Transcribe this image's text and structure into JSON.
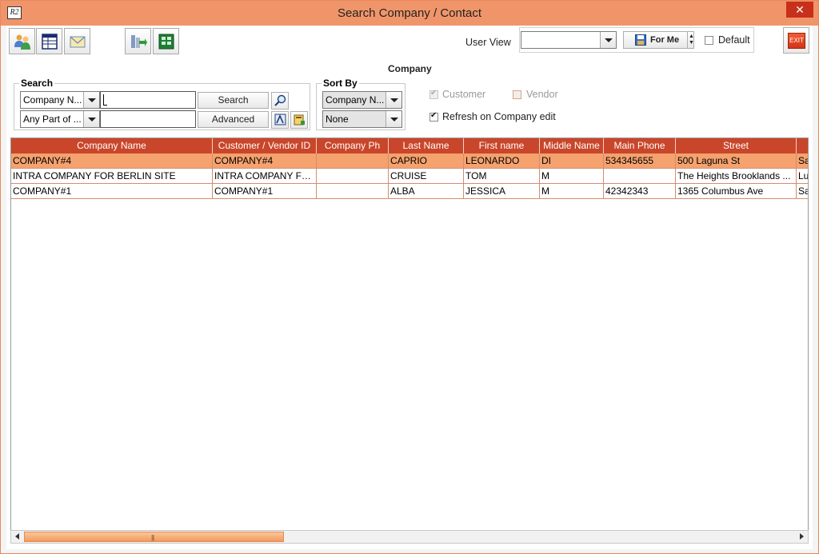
{
  "window": {
    "title": "Search Company / Contact",
    "app_icon_text": "R2",
    "close_symbol": "✕"
  },
  "toolbar": {
    "buttons": [
      {
        "icon": "contacts-icon"
      },
      {
        "icon": "table-window-icon"
      },
      {
        "icon": "envelope-icon"
      },
      {
        "icon": "export-icon"
      },
      {
        "icon": "spreadsheet-icon"
      }
    ],
    "user_view_label": "User View",
    "user_view_value": "",
    "for_me_label": "For Me",
    "default_label": "Default",
    "default_checked": false,
    "exit_label": "EXIT"
  },
  "section_title": "Company",
  "search": {
    "legend": "Search",
    "field_select": "Company N...",
    "match_select": "Any Part of ...",
    "query_value": "",
    "second_value": "",
    "search_button": "Search",
    "advanced_button": "Advanced"
  },
  "sort": {
    "legend": "Sort By",
    "primary": "Company N...",
    "secondary": "None"
  },
  "filters": {
    "customer_label": "Customer",
    "customer_checked": true,
    "vendor_label": "Vendor",
    "vendor_checked": false,
    "refresh_label": "Refresh on Company edit",
    "refresh_checked": true
  },
  "table": {
    "columns": [
      "Company Name",
      "Customer / Vendor ID",
      "Company Ph",
      "Last Name",
      "First name",
      "Middle Name",
      "Main Phone",
      "Street",
      ""
    ],
    "rows": [
      [
        "COMPANY#4",
        "COMPANY#4",
        "",
        "CAPRIO",
        "LEONARDO",
        "DI",
        "534345655",
        "500 Laguna St",
        "Sa"
      ],
      [
        "INTRA COMPANY FOR BERLIN SITE",
        "INTRA COMPANY FO...",
        "",
        "CRUISE",
        "TOM",
        "M",
        "",
        "The Heights Brooklands ...",
        "Lu"
      ],
      [
        "COMPANY#1",
        "COMPANY#1",
        "",
        "ALBA",
        "JESSICA",
        "M",
        "42342343",
        "1365 Columbus Ave",
        "Sa"
      ]
    ],
    "selected_row": 0
  },
  "colors": {
    "title_bar": "#F0956A",
    "header": "#C9462A",
    "selected_row": "#F5A26E",
    "exit_button": "#E8441C"
  }
}
